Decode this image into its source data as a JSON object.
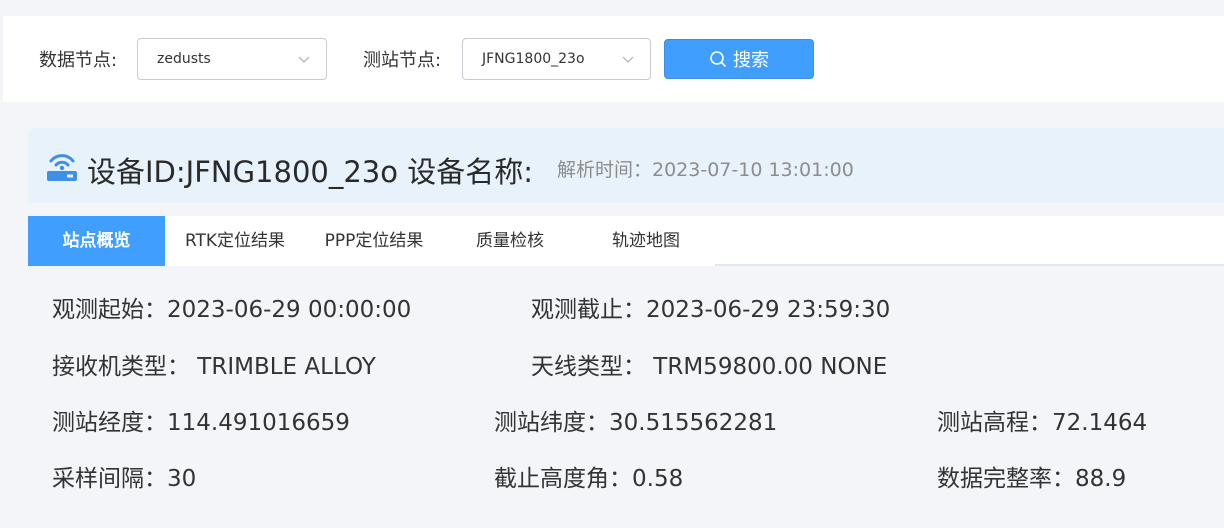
{
  "filters": {
    "data_node_label": "数据节点:",
    "data_node_value": "zedusts",
    "station_node_label": "测站节点:",
    "station_node_value": "JFNG1800_23o",
    "search_label": "搜索"
  },
  "device": {
    "title": "设备ID:JFNG1800_23o 设备名称:",
    "parse_time": "解析时间：2023-07-10 13:01:00"
  },
  "tabs": [
    {
      "label": "站点概览",
      "active": true
    },
    {
      "label": "RTK定位结果",
      "active": false
    },
    {
      "label": "PPP定位结果",
      "active": false
    },
    {
      "label": "质量检核",
      "active": false
    },
    {
      "label": "轨迹地图",
      "active": false
    }
  ],
  "info": {
    "obs_start": "观测起始：2023-06-29 00:00:00",
    "obs_end": "观测截止：2023-06-29 23:59:30",
    "receiver_type": "接收机类型： TRIMBLE ALLOY",
    "antenna_type": "天线类型： TRM59800.00 NONE",
    "longitude": "测站经度：114.491016659",
    "latitude": "测站纬度：30.515562281",
    "elevation": "测站高程：72.1464",
    "sampling": "采样间隔：30",
    "cutoff": "截止高度角：0.58",
    "completeness": "数据完整率：88.9"
  },
  "colors": {
    "primary": "#409eff",
    "header_bg": "#e8f2fb",
    "page_bg": "#f3f5f8"
  },
  "icons": {
    "device": "router-icon",
    "search": "search-icon",
    "dropdown": "chevron-down-icon"
  }
}
